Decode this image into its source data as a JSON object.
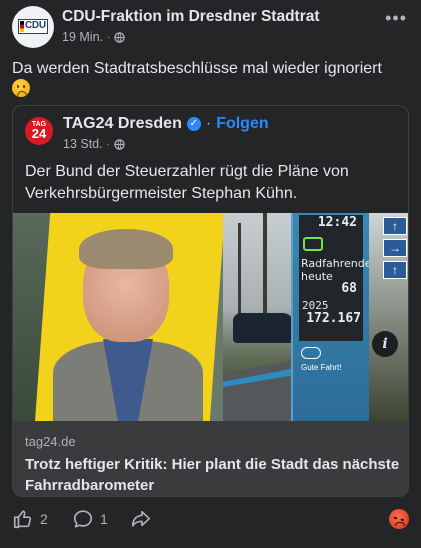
{
  "post": {
    "author": "CDU-Fraktion im Dresdner Stadtrat",
    "avatar_text": "CDU",
    "time": "19 Min.",
    "dot": "·",
    "more": "•••",
    "text": "Da werden Stadtratsbeschlüsse mal wieder ignoriert",
    "emoji_icon": "disappointed-face-emoji"
  },
  "shared": {
    "avatar_line1": "TAG",
    "avatar_line2": "24",
    "name": "TAG24 Dresden",
    "verified": "✓",
    "separator": "·",
    "follow": "Folgen",
    "time": "13 Std.",
    "dot": "·",
    "text": "Der Bund der Steuerzahler rügt die Pläne von Verkehrsbürgermeister Stephan Kühn."
  },
  "image": {
    "board_clock": "12:42",
    "board_label": "Radfahrende heute",
    "board_today": "68",
    "board_year": "2025",
    "board_total": "172.167",
    "board_slogan": "Gute Fahrt!",
    "info_icon": "i"
  },
  "link": {
    "domain": "tag24.de",
    "headline": "Trotz heftiger Kritik: Hier plant die Stadt das nächste Fahrradbarometer"
  },
  "actions": {
    "likes": "2",
    "comments": "1",
    "reaction_icon": "angry-face-emoji"
  },
  "colors": {
    "background": "#242526",
    "link_box": "#3a3b3c",
    "accent": "#2d88ff",
    "tag24_red": "#d61c22"
  }
}
